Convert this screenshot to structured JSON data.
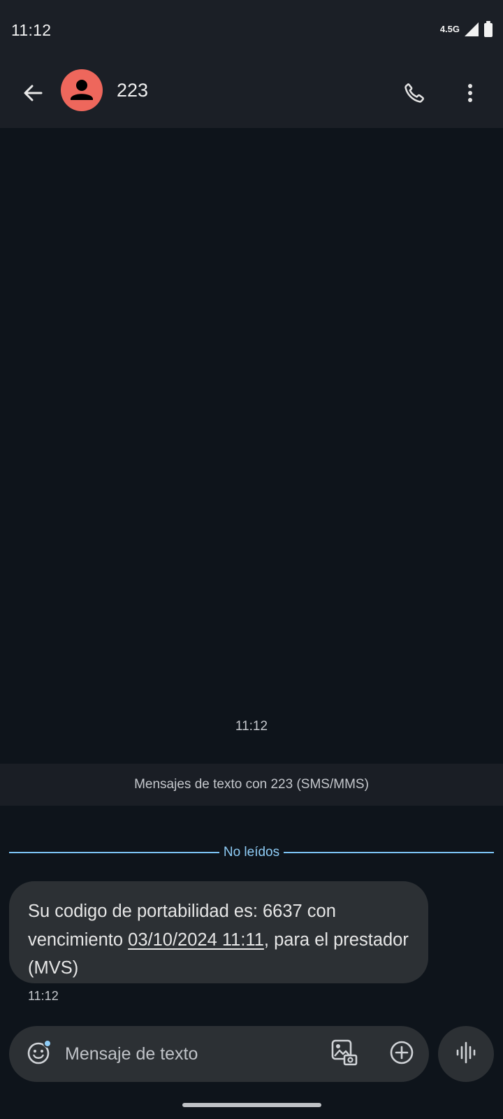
{
  "status_bar": {
    "time": "11:12",
    "network": "4.5G",
    "signal_icon": "signal-icon",
    "battery_icon": "battery-icon"
  },
  "header": {
    "back_icon": "arrow-back-icon",
    "contact_name": "223",
    "avatar_color": "#ee675c",
    "call_icon": "phone-icon",
    "more_icon": "more-vert-icon"
  },
  "thread": {
    "top_timestamp": "11:12",
    "sms_banner": "Mensajes de texto con 223 (SMS/MMS)",
    "unread_divider": "No leídos",
    "messages": [
      {
        "text_before_link": "Su codigo de portabilidad es: 6637 con vencimiento ",
        "link_text": "03/10/2024 11:11",
        "text_after_link": ", para el prestador (MVS)",
        "time": "11:12"
      }
    ]
  },
  "composer": {
    "placeholder": "Mensaje de texto",
    "emoji_icon": "emoji-icon",
    "gallery_icon": "gallery-icon",
    "add_icon": "add-circle-icon",
    "voice_icon": "voice-waveform-icon"
  },
  "colors": {
    "background": "#0e141b",
    "bars": "#1b1f26",
    "bubble": "#2c3034",
    "accent": "#7cc4f5"
  }
}
